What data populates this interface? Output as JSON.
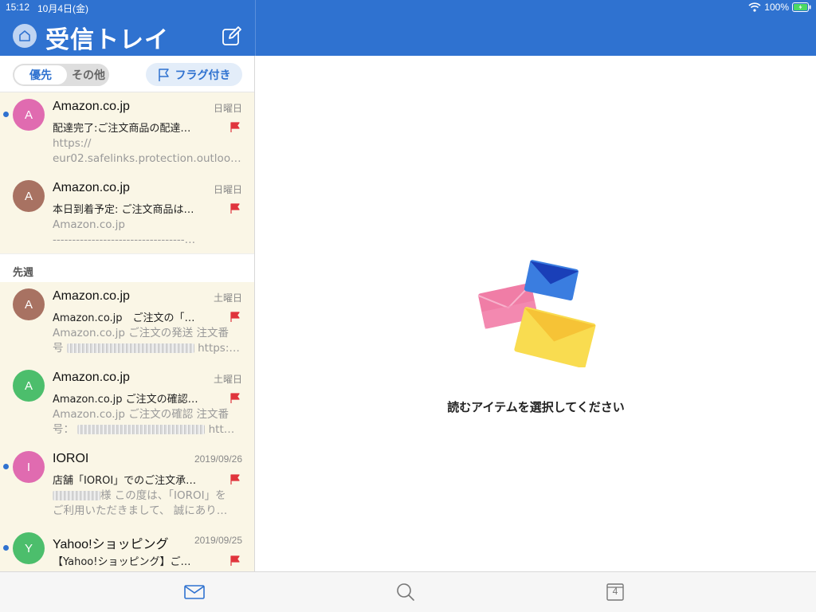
{
  "status_bar": {
    "time": "15:12",
    "date": "10月4日(金)",
    "battery": "100%"
  },
  "header": {
    "title": "受信トレイ"
  },
  "filters": {
    "focused": "優先",
    "other": "その他",
    "flagged": "フラグ付き"
  },
  "section_last_week": "先週",
  "emails": [
    {
      "initial": "A",
      "avatar_color": "#e06bb0",
      "sender": "Amazon.co.jp",
      "date": "日曜日",
      "subject": "配達完了:ご注文商品の配達…",
      "preview_line1": "https://",
      "preview_line2": "eur02.safelinks.protection.outloo…",
      "unread": true,
      "flagged": true
    },
    {
      "initial": "A",
      "avatar_color": "#a87262",
      "sender": "Amazon.co.jp",
      "date": "日曜日",
      "subject": "本日到着予定: ご注文商品は…",
      "preview_line1": "Amazon.co.jp",
      "preview_line2": "----------------------------------…",
      "unread": false,
      "flagged": true
    },
    {
      "initial": "A",
      "avatar_color": "#a87262",
      "sender": "Amazon.co.jp",
      "date": "土曜日",
      "subject": "Amazon.co.jp　ご注文の「…",
      "preview_line1": "Amazon.co.jp ご注文の発送 注文番",
      "preview_line2": "号",
      "preview_line2_tail": "https:…",
      "unread": false,
      "flagged": true
    },
    {
      "initial": "A",
      "avatar_color": "#4cbe6c",
      "sender": "Amazon.co.jp",
      "date": "土曜日",
      "subject": "Amazon.co.jp ご注文の確認…",
      "preview_line1": "Amazon.co.jp ご注文の確認 注文番",
      "preview_line2": "号：",
      "preview_line2_tail": "htt…",
      "unread": false,
      "flagged": true
    },
    {
      "initial": "I",
      "avatar_color": "#e06bb0",
      "sender": "IOROI",
      "date": "2019/09/26",
      "subject": "店舗「IOROI」でのご注文承…",
      "preview_line1": "様 この度は、「IOROI」を",
      "preview_line2": "ご利用いただきまして、 誠にあり…",
      "unread": true,
      "flagged": true
    },
    {
      "initial": "Y",
      "avatar_color": "#4cbe6c",
      "sender": "Yahoo!ショッピング",
      "date": "2019/09/25",
      "subject": "【Yahoo!ショッピング】ご…",
      "preview_line1": "",
      "preview_line2": "",
      "unread": true,
      "flagged": true
    }
  ],
  "reading_pane": {
    "empty_message": "読むアイテムを選択してください"
  },
  "tabs": {
    "calendar_day": "4"
  },
  "colors": {
    "brand": "#2f72d0",
    "unread_bg": "#faf6e6",
    "flag_red": "#e0343c"
  }
}
